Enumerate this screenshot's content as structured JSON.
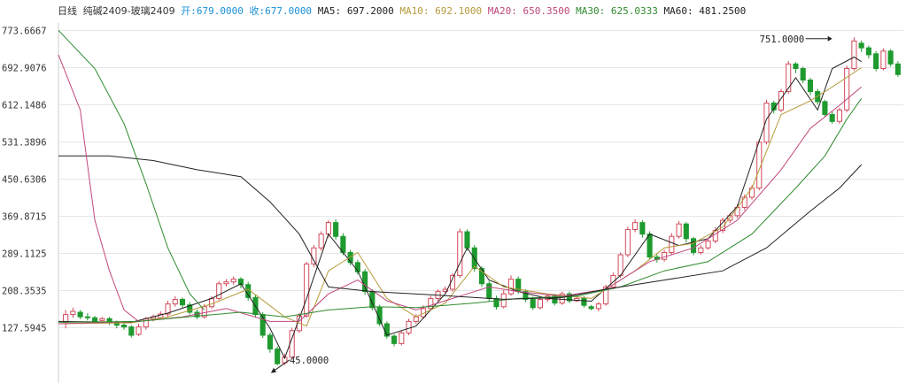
{
  "header": {
    "period": "日线",
    "symbol": "纯碱2409-玻璃2409",
    "open_label": "开:",
    "open_value": "679.0000",
    "close_label": "收:",
    "close_value": "677.0000",
    "ma5_label": "MA5:",
    "ma5_value": "697.2000",
    "ma10_label": "MA10:",
    "ma10_value": "692.1000",
    "ma20_label": "MA20:",
    "ma20_value": "650.3500",
    "ma30_label": "MA30:",
    "ma30_value": "625.0333",
    "ma60_label": "MA60:",
    "ma60_value": "481.2500"
  },
  "colors": {
    "up": "#d24a5a",
    "down": "#1e9a2f",
    "ma5": "#222222",
    "ma10": "#b59a3a",
    "ma20": "#c0477e",
    "ma30": "#2e8b2e",
    "ma60": "#222222",
    "grid": "#e6e6e6"
  },
  "chart_data": {
    "type": "candlestick",
    "y_ticks": [
      "773.6667",
      "692.9076",
      "612.1486",
      "531.3896",
      "450.6306",
      "369.8715",
      "289.1125",
      "208.3535",
      "127.5945"
    ],
    "ylim": [
      46.5,
      773.6667
    ],
    "grid": true,
    "annotations": [
      {
        "text": "751.0000",
        "type": "max",
        "index": 105,
        "value": 751
      },
      {
        "text": "45.0000",
        "type": "min",
        "index": 28,
        "value": 45
      }
    ],
    "candles": [
      [
        138,
        155,
        165,
        125
      ],
      [
        155,
        162,
        170,
        148
      ],
      [
        160,
        150,
        165,
        145
      ],
      [
        150,
        148,
        158,
        142
      ],
      [
        148,
        140,
        152,
        135
      ],
      [
        142,
        146,
        150,
        138
      ],
      [
        146,
        138,
        150,
        132
      ],
      [
        138,
        132,
        142,
        125
      ],
      [
        132,
        128,
        136,
        122
      ],
      [
        128,
        110,
        132,
        105
      ],
      [
        112,
        128,
        135,
        108
      ],
      [
        128,
        146,
        150,
        122
      ],
      [
        146,
        150,
        155,
        140
      ],
      [
        148,
        156,
        162,
        144
      ],
      [
        156,
        178,
        185,
        150
      ],
      [
        178,
        188,
        195,
        172
      ],
      [
        188,
        176,
        192,
        168
      ],
      [
        176,
        160,
        182,
        155
      ],
      [
        160,
        150,
        166,
        145
      ],
      [
        150,
        172,
        178,
        146
      ],
      [
        172,
        190,
        195,
        168
      ],
      [
        190,
        222,
        228,
        186
      ],
      [
        222,
        226,
        232,
        216
      ],
      [
        226,
        232,
        238,
        220
      ],
      [
        232,
        220,
        236,
        212
      ],
      [
        220,
        192,
        226,
        185
      ],
      [
        192,
        155,
        198,
        148
      ],
      [
        155,
        110,
        160,
        104
      ],
      [
        110,
        80,
        116,
        72
      ],
      [
        80,
        48,
        86,
        45
      ],
      [
        50,
        62,
        70,
        45
      ],
      [
        62,
        120,
        126,
        58
      ],
      [
        120,
        152,
        158,
        115
      ],
      [
        152,
        265,
        270,
        148
      ],
      [
        265,
        300,
        306,
        258
      ],
      [
        300,
        330,
        336,
        294
      ],
      [
        330,
        355,
        360,
        322
      ],
      [
        355,
        325,
        362,
        318
      ],
      [
        325,
        290,
        332,
        284
      ],
      [
        290,
        268,
        296,
        262
      ],
      [
        268,
        248,
        274,
        242
      ],
      [
        248,
        205,
        254,
        198
      ],
      [
        205,
        170,
        210,
        164
      ],
      [
        170,
        135,
        176,
        130
      ],
      [
        135,
        108,
        140,
        102
      ],
      [
        108,
        92,
        112,
        86
      ],
      [
        92,
        115,
        120,
        88
      ],
      [
        115,
        140,
        146,
        110
      ],
      [
        140,
        150,
        156,
        135
      ],
      [
        150,
        168,
        175,
        145
      ],
      [
        168,
        190,
        196,
        163
      ],
      [
        190,
        205,
        210,
        185
      ],
      [
        205,
        210,
        216,
        200
      ],
      [
        210,
        240,
        245,
        205
      ],
      [
        240,
        335,
        342,
        235
      ],
      [
        335,
        300,
        340,
        294
      ],
      [
        300,
        255,
        306,
        248
      ],
      [
        255,
        222,
        260,
        215
      ],
      [
        222,
        190,
        228,
        184
      ],
      [
        190,
        172,
        196,
        166
      ],
      [
        172,
        200,
        208,
        168
      ],
      [
        200,
        232,
        240,
        196
      ],
      [
        232,
        205,
        238,
        200
      ],
      [
        205,
        188,
        210,
        182
      ],
      [
        188,
        170,
        194,
        165
      ],
      [
        170,
        188,
        195,
        166
      ],
      [
        188,
        195,
        200,
        182
      ],
      [
        195,
        180,
        200,
        175
      ],
      [
        180,
        200,
        205,
        176
      ],
      [
        200,
        185,
        205,
        180
      ],
      [
        185,
        190,
        195,
        182
      ],
      [
        190,
        175,
        195,
        170
      ],
      [
        172,
        168,
        176,
        164
      ],
      [
        168,
        178,
        182,
        162
      ],
      [
        178,
        215,
        220,
        174
      ],
      [
        215,
        240,
        246,
        210
      ],
      [
        240,
        285,
        290,
        235
      ],
      [
        285,
        340,
        346,
        280
      ],
      [
        340,
        355,
        362,
        334
      ],
      [
        355,
        330,
        360,
        322
      ],
      [
        330,
        280,
        336,
        274
      ],
      [
        280,
        275,
        286,
        268
      ],
      [
        275,
        290,
        296,
        270
      ],
      [
        290,
        325,
        332,
        285
      ],
      [
        325,
        352,
        358,
        320
      ],
      [
        352,
        320,
        356,
        312
      ],
      [
        320,
        290,
        324,
        284
      ],
      [
        290,
        300,
        306,
        285
      ],
      [
        300,
        315,
        322,
        296
      ],
      [
        315,
        338,
        345,
        310
      ],
      [
        338,
        360,
        366,
        332
      ],
      [
        360,
        370,
        376,
        354
      ],
      [
        370,
        388,
        395,
        365
      ],
      [
        388,
        410,
        416,
        382
      ],
      [
        410,
        430,
        436,
        405
      ],
      [
        430,
        530,
        536,
        425
      ],
      [
        530,
        615,
        622,
        525
      ],
      [
        615,
        600,
        620,
        592
      ],
      [
        600,
        640,
        646,
        595
      ],
      [
        640,
        700,
        706,
        635
      ],
      [
        700,
        690,
        704,
        680
      ],
      [
        690,
        665,
        694,
        658
      ],
      [
        665,
        640,
        670,
        632
      ],
      [
        640,
        618,
        646,
        612
      ],
      [
        618,
        590,
        622,
        585
      ],
      [
        590,
        575,
        596,
        570
      ],
      [
        575,
        600,
        605,
        570
      ],
      [
        600,
        690,
        696,
        595
      ],
      [
        690,
        750,
        758,
        685
      ],
      [
        745,
        735,
        751,
        726
      ],
      [
        735,
        720,
        740,
        712
      ],
      [
        722,
        690,
        728,
        684
      ],
      [
        690,
        728,
        734,
        686
      ],
      [
        728,
        700,
        732,
        694
      ],
      [
        700,
        677,
        706,
        672
      ]
    ],
    "moving_averages": {
      "MA5": [
        [
          0,
          140
        ],
        [
          9,
          138
        ],
        [
          14,
          158
        ],
        [
          20,
          190
        ],
        [
          24,
          222
        ],
        [
          28,
          125
        ],
        [
          30,
          60
        ],
        [
          33,
          190
        ],
        [
          36,
          330
        ],
        [
          40,
          250
        ],
        [
          44,
          110
        ],
        [
          48,
          130
        ],
        [
          52,
          200
        ],
        [
          55,
          300
        ],
        [
          58,
          230
        ],
        [
          62,
          205
        ],
        [
          66,
          190
        ],
        [
          72,
          184
        ],
        [
          76,
          240
        ],
        [
          80,
          330
        ],
        [
          84,
          305
        ],
        [
          88,
          320
        ],
        [
          92,
          390
        ],
        [
          96,
          580
        ],
        [
          100,
          670
        ],
        [
          103,
          600
        ],
        [
          105,
          690
        ],
        [
          108,
          715
        ],
        [
          109,
          705
        ]
      ],
      "MA10": [
        [
          0,
          135
        ],
        [
          9,
          137
        ],
        [
          14,
          150
        ],
        [
          20,
          178
        ],
        [
          25,
          210
        ],
        [
          30,
          150
        ],
        [
          33,
          130
        ],
        [
          36,
          250
        ],
        [
          40,
          290
        ],
        [
          44,
          190
        ],
        [
          48,
          150
        ],
        [
          52,
          180
        ],
        [
          56,
          260
        ],
        [
          60,
          215
        ],
        [
          66,
          200
        ],
        [
          72,
          190
        ],
        [
          78,
          250
        ],
        [
          82,
          300
        ],
        [
          86,
          310
        ],
        [
          90,
          345
        ],
        [
          94,
          430
        ],
        [
          98,
          590
        ],
        [
          102,
          620
        ],
        [
          105,
          650
        ],
        [
          109,
          692
        ]
      ],
      "MA20": [
        [
          0,
          135
        ],
        [
          10,
          140
        ],
        [
          16,
          150
        ],
        [
          22,
          168
        ],
        [
          28,
          140
        ],
        [
          32,
          140
        ],
        [
          36,
          200
        ],
        [
          40,
          230
        ],
        [
          44,
          185
        ],
        [
          48,
          165
        ],
        [
          54,
          195
        ],
        [
          58,
          215
        ],
        [
          62,
          205
        ],
        [
          68,
          195
        ],
        [
          74,
          210
        ],
        [
          80,
          270
        ],
        [
          86,
          300
        ],
        [
          92,
          360
        ],
        [
          98,
          470
        ],
        [
          102,
          560
        ],
        [
          106,
          610
        ],
        [
          109,
          650
        ]
      ],
      "MA30": [
        [
          0,
          138
        ],
        [
          10,
          140
        ],
        [
          18,
          152
        ],
        [
          24,
          160
        ],
        [
          30,
          150
        ],
        [
          36,
          165
        ],
        [
          42,
          172
        ],
        [
          48,
          170
        ],
        [
          56,
          180
        ],
        [
          62,
          190
        ],
        [
          70,
          195
        ],
        [
          76,
          215
        ],
        [
          82,
          250
        ],
        [
          88,
          270
        ],
        [
          94,
          330
        ],
        [
          100,
          430
        ],
        [
          104,
          500
        ],
        [
          107,
          580
        ],
        [
          109,
          625
        ]
      ],
      "MA60": [
        [
          0,
          500
        ],
        [
          6,
          500
        ],
        [
          12,
          490
        ],
        [
          18,
          470
        ],
        [
          24,
          455
        ],
        [
          28,
          400
        ],
        [
          32,
          330
        ],
        [
          36,
          215
        ],
        [
          42,
          205
        ],
        [
          50,
          198
        ],
        [
          60,
          188
        ],
        [
          68,
          192
        ],
        [
          74,
          210
        ],
        [
          82,
          230
        ],
        [
          90,
          250
        ],
        [
          96,
          300
        ],
        [
          102,
          380
        ],
        [
          106,
          430
        ],
        [
          109,
          481
        ]
      ],
      "MA_left_red": [
        [
          0,
          720
        ],
        [
          2,
          600
        ],
        [
          4,
          360
        ],
        [
          6,
          250
        ],
        [
          8,
          165
        ],
        [
          10,
          140
        ]
      ],
      "MA_left_green": [
        [
          0,
          773
        ],
        [
          4,
          690
        ],
        [
          8,
          570
        ],
        [
          11,
          440
        ],
        [
          14,
          300
        ],
        [
          17,
          200
        ],
        [
          19,
          165
        ]
      ]
    }
  }
}
